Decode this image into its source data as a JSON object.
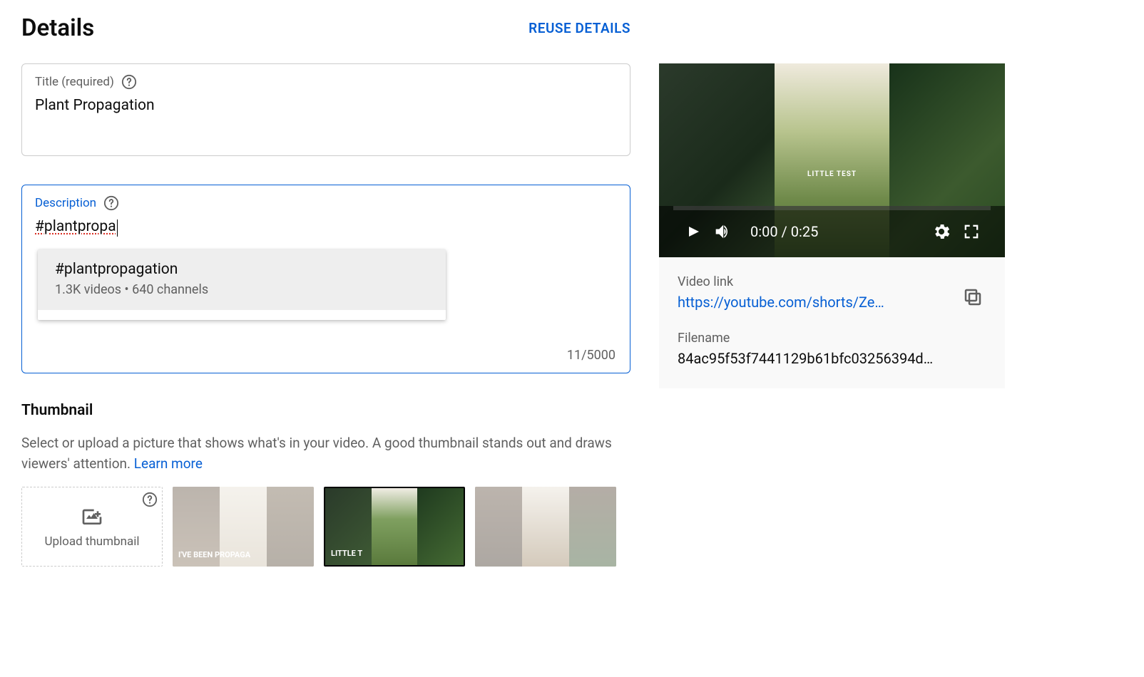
{
  "header": {
    "title": "Details",
    "reuse": "REUSE DETAILS"
  },
  "titleField": {
    "label": "Title (required)",
    "value": "Plant Propagation"
  },
  "descField": {
    "label": "Description",
    "value": "#plantpropa",
    "counter": "11/5000",
    "suggestion": {
      "tag": "#plantpropagation",
      "meta": "1.3K videos • 640 channels"
    }
  },
  "thumbnail": {
    "heading": "Thumbnail",
    "desc_a": "Select or upload a picture that shows what's in your video. A good thumbnail stands out and draws viewers' attention. ",
    "learn": "Learn more",
    "upload": "Upload thumbnail",
    "overlay1": "I'VE BEEN PROPAGA",
    "overlay2": "LITTLE T"
  },
  "player": {
    "overlay": "LITTLE TEST",
    "time": "0:00 / 0:25"
  },
  "meta": {
    "linkLabel": "Video link",
    "link": "https://youtube.com/shorts/Ze…",
    "fileLabel": "Filename",
    "file": "84ac95f53f7441129b61bfc03256394d…"
  }
}
